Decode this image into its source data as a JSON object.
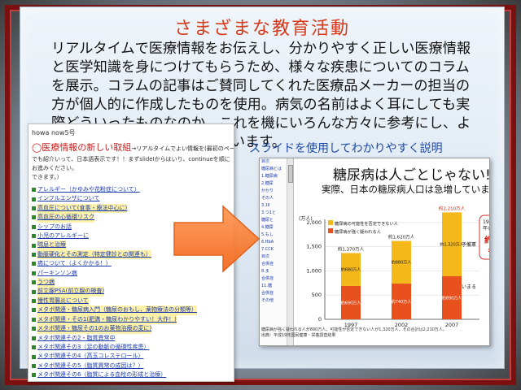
{
  "slide": {
    "title": "さまざまな教育活動",
    "body": "リアルタイムで医療情報をお伝えし、分かりやすく正しい医療情報と医学知識を身につけてもらうため、様々な疾患についてのコラムを展示。コラムの記事はご賛同してくれた医療品メーカーの担当の方が個人的に作成したものを使用。病気の名前はよく耳にしても実際どういったものなのか、これを機にいろんな方々に参考にし、よく知ってもらいたいと考えています。",
    "caption": "スライドを使用してわかりやすく説明"
  },
  "webpage": {
    "header": "howa now5号",
    "heading": "◯医療情報の新しい取組",
    "heading_rest": "→リアルタイムでよい情報を(最初のページ",
    "desc": "でも紹介いって、日本語表示です！！まずslideIからはいり、continueを順にお進みください。",
    "desc2": "できます。）",
    "items": [
      "アレルギー（かゆみや花粉症について）",
      "インフルエンザについて",
      "高血圧について(食事・療法中心に)",
      "高血圧の心循環リスク",
      "シップのお話",
      "小児のアレルギーに",
      "喘息と治療",
      "動脈硬化とその測定（特定健診との関連も）",
      "癌について（よくかかる！）",
      "パーキンソン病",
      "うつ病",
      "前立腺PSA(前立腺の検査)",
      "慢性胃腸炎について",
      "メタボ関連・糖尿病入門（糖尿のおもし、薬物療法の分類等）",
      "メタボ関連・その1(肥満・糖尿わかりやすい！大作！)",
      "メタボ関連・糖尿その1のお薬物治療の変に)",
      "メタボ関連その2・脂質異常中",
      "メタボ関連その3（足の動脈の循環性疾患）",
      "メタボ関連その4（高玉コレステロール）",
      "メタボ関連その5（脂質異常の成因は？）",
      "メタボ関連その6（脂質による血栓の形成と治療）"
    ],
    "highlighted": [
      2,
      3,
      6,
      7,
      10,
      11,
      12,
      13,
      14,
      15
    ]
  },
  "slide_shot": {
    "title": "糖尿病は人ごとじゃない!!",
    "subtitle": "実際、日本の糖尿病人口は急増していま",
    "nav": [
      "目次",
      "糖尿病とは",
      "1.糖尿病",
      "2.糖尿",
      "かかり",
      "その人",
      "3.1Ⅱ",
      "3.つ1と",
      "糖尿と",
      "4.糖尿",
      "5.もし",
      "6.HbA",
      "7.CCK",
      "目次",
      "合併症",
      "8.ま",
      "合併症",
      "11.糖",
      "合併症",
      "その他"
    ],
    "note": "糖尿病が強く疑われる人が890万人、可能性が否定できない人が1,320万人、その合計は2,210万人。出典：平成19年国民健康・栄養調査結果"
  },
  "chart_data": {
    "type": "bar",
    "title": "",
    "ylabel": "(万人)",
    "xlabel": "",
    "categories": [
      "1997",
      "2002",
      "2007"
    ],
    "ylim": [
      0,
      2500
    ],
    "yticks": [
      0,
      500,
      1000,
      1500,
      2000
    ],
    "series": [
      {
        "name": "糖尿病が強く疑われる人",
        "values": [
          690,
          740,
          890
        ],
        "color": "#e8501e"
      },
      {
        "name": "糖尿病の可能性を否定できない人",
        "values": [
          680,
          880,
          1320
        ],
        "color": "#f5b81a"
      }
    ],
    "totals": [
      "約1,370万人",
      "約1,620万人",
      "約2,210万人"
    ],
    "bottom_labels": [
      "約690万人",
      "約740万人",
      "約890万人"
    ],
    "top_labels": [
      "約680万人",
      "約880万人",
      "約1,320万人"
    ],
    "annotations": [
      "予備軍",
      "いまる",
      "1997年から",
      "年のわずか",
      "約2",
      "も"
    ]
  }
}
